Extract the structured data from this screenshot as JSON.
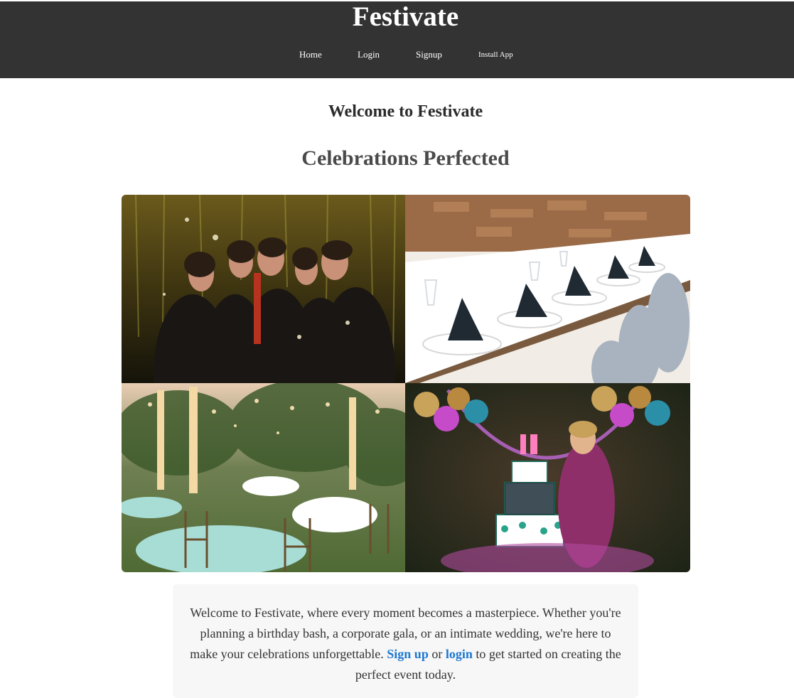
{
  "header": {
    "brand": "Festivate",
    "nav": [
      {
        "label": "Home"
      },
      {
        "label": "Login"
      },
      {
        "label": "Signup"
      },
      {
        "label": "Install App"
      }
    ]
  },
  "main": {
    "welcome_heading": "Welcome to Festivate",
    "tagline": "Celebrations Perfected",
    "gallery": [
      {
        "subject": "party-friends-photo"
      },
      {
        "subject": "banquet-table-photo"
      },
      {
        "subject": "garden-reception-photo"
      },
      {
        "subject": "birthday-cake-photo"
      }
    ],
    "intro": {
      "before": "Welcome to Festivate, where every moment becomes a masterpiece. Whether you're planning a birthday bash, a corporate gala, or an intimate wedding, we're here to make your celebrations unforgettable. ",
      "signup_link": "Sign up",
      "middle": " or ",
      "login_link": "login",
      "after": " to get started on creating the perfect event today."
    }
  },
  "colors": {
    "header_bg": "#333333",
    "link": "#1f78d1",
    "card_bg": "#f7f7f7"
  }
}
